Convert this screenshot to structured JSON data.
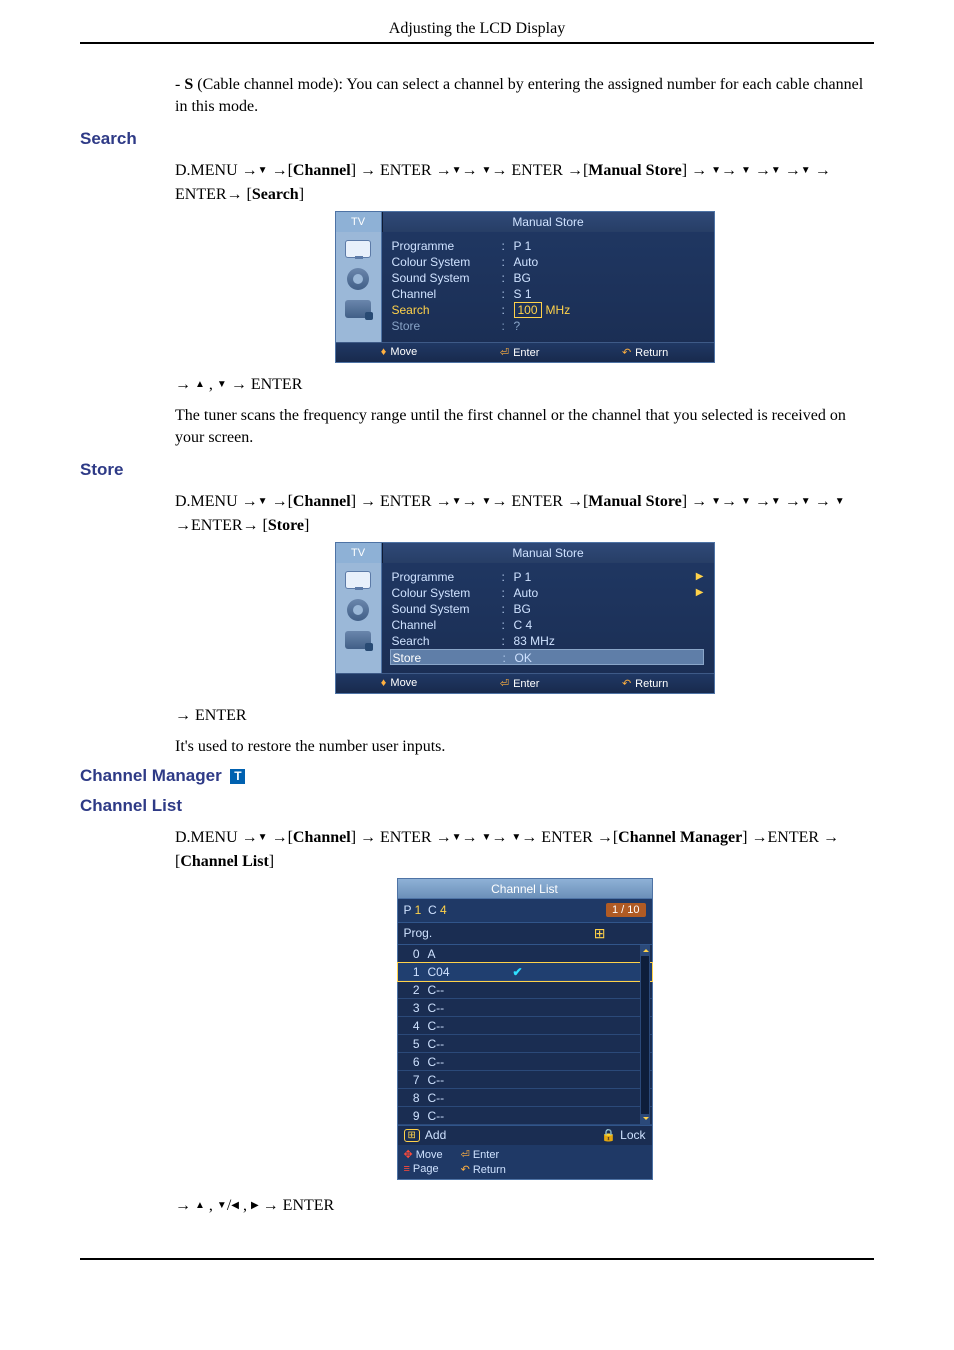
{
  "page_header": "Adjusting the LCD Display",
  "intro_text": "- <b>S</b> (Cable channel mode): You can select a channel by entering the assigned number for each cable channel in this mode.",
  "search": {
    "heading": "Search",
    "path_html": "D.MENU →<span class='tri-down'></span> →[<b>Channel</b>] → ENTER →<span class='tri-down'></span>→ <span class='tri-down'></span>→ ENTER →[<b>Manual Store</b>] → <span class='tri-down'></span>→ <span class='tri-down'></span> →<span class='tri-down'></span> →<span class='tri-down'></span> → ENTER→ [<b>Search</b>]",
    "after_html": "→ <span class='tri-up'></span> , <span class='tri-down'></span> → ENTER",
    "desc": "The tuner scans the frequency range until the first channel or the channel that you selected is received on your screen.",
    "osd": {
      "tab_left": "TV",
      "title": "Manual Store",
      "rows": [
        {
          "label": "Programme",
          "val": "P   1"
        },
        {
          "label": "Colour System",
          "val": "Auto"
        },
        {
          "label": "Sound System",
          "val": "BG"
        },
        {
          "label": "Channel",
          "val": "S   1"
        },
        {
          "label": "Search",
          "val_html": "<span class='boxmark'>100</span><span class='mhz'>MHz</span>",
          "sel": true
        },
        {
          "label": "Store",
          "val": "?",
          "muted": true
        }
      ],
      "foot": {
        "move": "Move",
        "enter": "Enter",
        "return": "Return"
      }
    }
  },
  "store": {
    "heading": "Store",
    "path_html": "D.MENU →<span class='tri-down'></span> →[<b>Channel</b>] → ENTER →<span class='tri-down'></span>→ <span class='tri-down'></span>→ ENTER →[<b>Manual Store</b>] → <span class='tri-down'></span>→ <span class='tri-down'></span> →<span class='tri-down'></span> →<span class='tri-down'></span> → <span class='tri-down'></span> →ENTER→ [<b>Store</b>]",
    "after_html": "→ ENTER",
    "desc": "It's used to restore the number user inputs.",
    "osd": {
      "tab_left": "TV",
      "title": "Manual Store",
      "rows": [
        {
          "label": "Programme",
          "val": "P   1",
          "arrow": true
        },
        {
          "label": "Colour System",
          "val": "Auto",
          "arrow": true
        },
        {
          "label": "Sound System",
          "val": "BG"
        },
        {
          "label": "Channel",
          "val": "C   4"
        },
        {
          "label": "Search",
          "val": "83   MHz"
        },
        {
          "label": "Store",
          "val": "OK",
          "hl": true
        }
      ],
      "foot": {
        "move": "Move",
        "enter": "Enter",
        "return": "Return"
      }
    }
  },
  "channel_manager": {
    "heading": "Channel Manager",
    "t_icon": "T",
    "list_heading": "Channel List",
    "path_html": "D.MENU →<span class='tri-down'></span> →[<b>Channel</b>] → ENTER →<span class='tri-down'></span>→ <span class='tri-down'></span>→ <span class='tri-down'></span>→ ENTER →[<b>Channel Manager</b>] →ENTER → [<b>Channel List</b>]",
    "after_html": "→ <span class='tri-up'></span> , <span class='tri-down'></span>/<span class='tri-left'></span> , <span class='tri-right'></span> → ENTER",
    "list": {
      "title": "Channel List",
      "pc_html": "P <b>1</b>&nbsp;&nbsp;C <b>4</b>",
      "count": "1 / 10",
      "prog": "Prog.",
      "header": {
        "c1": "",
        "c2": "",
        "c3": ""
      },
      "rows": [
        {
          "n": "0",
          "ch": "A",
          "check": false,
          "sel": false
        },
        {
          "n": "1",
          "ch": "C04",
          "check": true,
          "sel": true
        },
        {
          "n": "2",
          "ch": "C--"
        },
        {
          "n": "3",
          "ch": "C--"
        },
        {
          "n": "4",
          "ch": "C--"
        },
        {
          "n": "5",
          "ch": "C--"
        },
        {
          "n": "6",
          "ch": "C--"
        },
        {
          "n": "7",
          "ch": "C--"
        },
        {
          "n": "8",
          "ch": "C--"
        },
        {
          "n": "9",
          "ch": "C--"
        }
      ],
      "foot1": {
        "add": "Add",
        "lock": "Lock"
      },
      "foot2": {
        "move": "Move",
        "page": "Page",
        "enter": "Enter",
        "return": "Return"
      }
    }
  }
}
